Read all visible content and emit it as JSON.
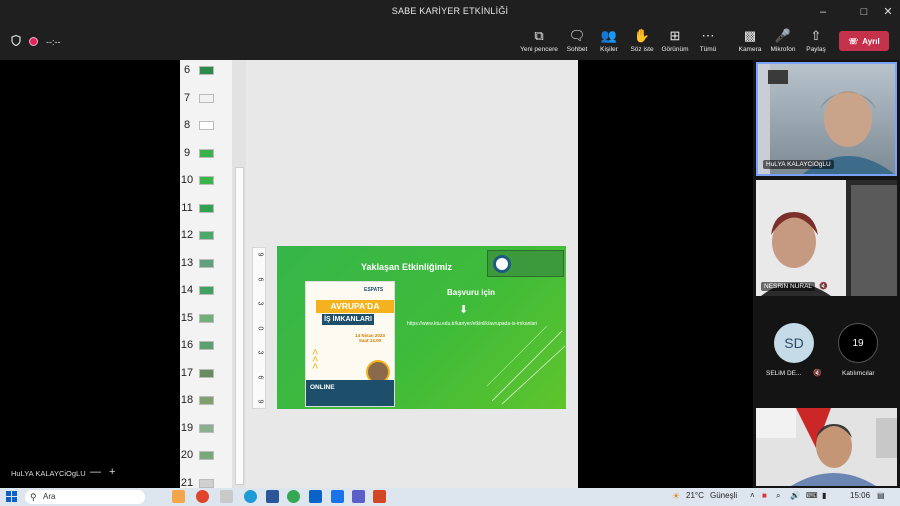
{
  "window": {
    "title": "SABE KARİYER ETKİNLİĞİ"
  },
  "meeting": {
    "timer": "--:--"
  },
  "toolbar": {
    "new_window": "Yeni pencere",
    "chat": "Sohbet",
    "people": "Kişiler",
    "raise_hand": "Söz iste",
    "view": "Görünüm",
    "more": "Tümü",
    "camera": "Kamera",
    "mic": "Mikrofon",
    "share": "Paylaş",
    "leave": "Ayrıl"
  },
  "slides_panel": {
    "numbers": [
      "6",
      "7",
      "8",
      "9",
      "10",
      "11",
      "12",
      "13",
      "14",
      "15",
      "16",
      "17",
      "18",
      "19",
      "20",
      "21"
    ]
  },
  "ruler": {
    "ticks": [
      "9",
      "6",
      "3",
      "0",
      "3",
      "6",
      "9"
    ]
  },
  "slide": {
    "heading": "Yaklaşan Etkinliğimiz",
    "apply": "Başvuru için",
    "url": "https://www.ktu.edu.tr/kariyer/etkinlik/avrupada-is-imkanlari",
    "poster": {
      "brand": "ESPATS",
      "title1": "AVRUPA'DA",
      "title2": "İŞ İMKANLARI",
      "date": "14 Nisan 2023 Saat:14.00",
      "mode": "ONLINE"
    }
  },
  "participants": [
    {
      "name": "HuLYA KALAYCiOgLU"
    },
    {
      "name": "NESRiN NURAL"
    },
    {
      "initials": "SD",
      "name": "SELiM DE..."
    },
    {
      "count": "19",
      "name": "Katılımcılar"
    }
  ],
  "presenter": {
    "name": "HuLYA KALAYCiOgLU"
  },
  "taskbar": {
    "search": "Ara",
    "temperature": "21°C",
    "weather": "Güneşli",
    "time": "15:06"
  },
  "colors": {
    "leave": "#c4314b",
    "slide_green": "#3fbb3a",
    "accent": "#f4b21e"
  }
}
